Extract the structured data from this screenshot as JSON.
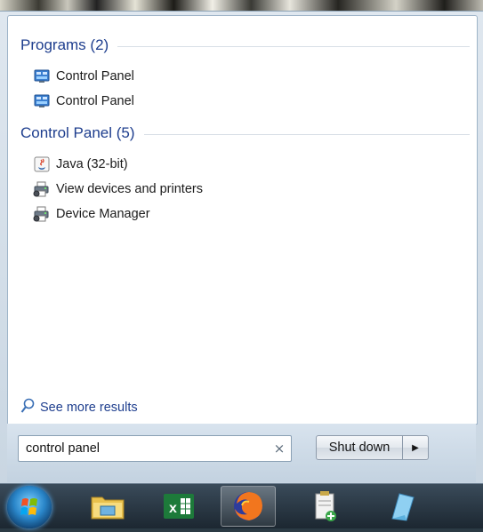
{
  "results": {
    "groups": [
      {
        "title": "Programs (2)",
        "items": [
          {
            "label": "Control Panel",
            "icon": "control-panel-icon"
          },
          {
            "label": "Control Panel",
            "icon": "control-panel-icon"
          }
        ]
      },
      {
        "title": "Control Panel (5)",
        "items": [
          {
            "label": "Java (32-bit)",
            "icon": "java-icon"
          },
          {
            "label": "View devices and printers",
            "icon": "printer-icon"
          },
          {
            "label": "Device Manager",
            "icon": "device-manager-icon"
          }
        ]
      }
    ],
    "see_more": "See more results"
  },
  "search": {
    "value": "control panel",
    "clear_glyph": "×"
  },
  "shutdown": {
    "label": "Shut down",
    "arrow_glyph": "▶"
  },
  "taskbar": {
    "items": [
      {
        "name": "start-orb-icon"
      },
      {
        "name": "file-explorer-icon"
      },
      {
        "name": "excel-icon"
      },
      {
        "name": "firefox-icon",
        "active": true
      },
      {
        "name": "notepad-new-icon"
      },
      {
        "name": "notes-icon"
      }
    ]
  },
  "colors": {
    "group_title": "#1e3e8e",
    "link": "#1e3e8e",
    "taskbar": "#1c2731"
  }
}
